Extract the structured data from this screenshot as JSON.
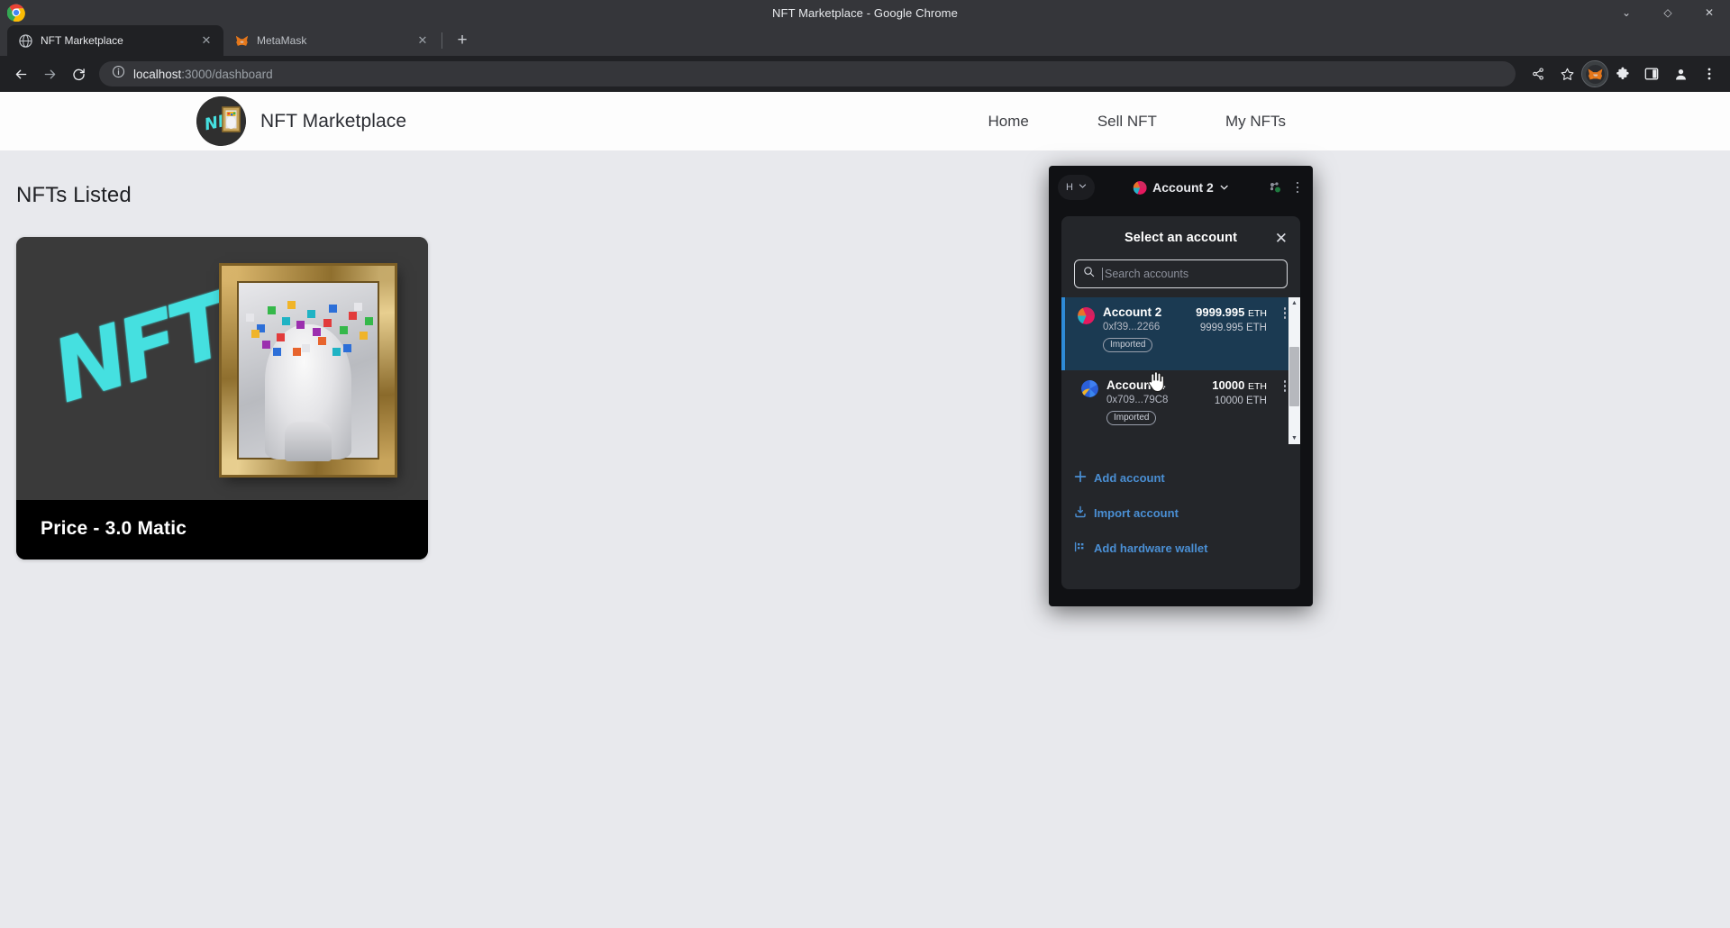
{
  "browser": {
    "window_title": "NFT Marketplace - Google Chrome",
    "window_controls": {
      "minimize": "⌄",
      "maximize": "◇",
      "close": "✕"
    },
    "tabs": [
      {
        "title": "NFT Marketplace",
        "favicon": "globe-icon",
        "active": true,
        "close": "✕"
      },
      {
        "title": "MetaMask",
        "favicon": "metamask-fox-icon",
        "active": false,
        "close": "✕"
      }
    ],
    "new_tab_label": "+",
    "nav": {
      "back": "←",
      "forward": "→",
      "reload": "⟳",
      "site_info": "ⓘ"
    },
    "omnibox": {
      "host": "localhost",
      "path": ":3000/dashboard",
      "full_url": "localhost:3000/dashboard"
    },
    "toolbar_icons": [
      "share-icon",
      "bookmark-star-icon",
      "metamask-extension-icon",
      "extensions-puzzle-icon",
      "side-panel-icon",
      "profile-icon",
      "chrome-menu-icon"
    ]
  },
  "site": {
    "brand": "NFT Marketplace",
    "nav_links": [
      "Home",
      "Sell NFT",
      "My NFTs"
    ],
    "section_title": "NFTs Listed",
    "cards": [
      {
        "price_label": "Price - 3.0 Matic",
        "alt": "NFT artwork - classical bust in gilded frame with pixel confetti"
      }
    ]
  },
  "metamask": {
    "network": {
      "label": "H",
      "chevron": "⌄"
    },
    "account_pill": {
      "name": "Account 2",
      "chevron": "⌄"
    },
    "header_icons": [
      "connection-status-icon",
      "global-menu-icon"
    ],
    "modal": {
      "title": "Select an account",
      "close": "✕",
      "search": {
        "placeholder": "Search accounts",
        "value": ""
      },
      "accounts": [
        {
          "name": "Account 2",
          "address": "0xf39...2266",
          "badge": "Imported",
          "balance": "9999.995",
          "currency": "ETH",
          "secondary_balance": "9999.995 ETH",
          "selected": true,
          "menu": "account-options-icon"
        },
        {
          "name": "Account 4",
          "address": "0x709...79C8",
          "badge": "Imported",
          "balance": "10000",
          "currency": "ETH",
          "secondary_balance": "10000 ETH",
          "selected": false,
          "menu": "account-options-icon"
        }
      ],
      "actions": [
        {
          "label": "Add account",
          "icon": "plus-icon"
        },
        {
          "label": "Import account",
          "icon": "download-icon"
        },
        {
          "label": "Add hardware wallet",
          "icon": "hardware-wallet-icon"
        }
      ]
    }
  },
  "colors": {
    "accent_blue": "#4a8fd4",
    "selected_row": "#1b3a52",
    "selected_bar": "#2e8bd8",
    "popup_bg": "#101114",
    "modal_bg": "#24262a",
    "page_bg": "#e8e9ed",
    "card_bg": "#3a3a3a",
    "nft_cyan": "#45e0e0"
  }
}
